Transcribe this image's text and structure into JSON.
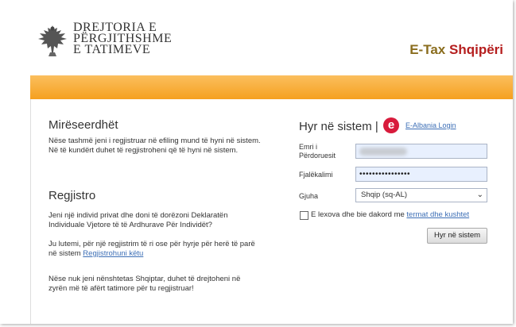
{
  "header": {
    "logo_lines": [
      "DREJTORIA E",
      "PËRGJITHSHME",
      "E TATIMEVE"
    ],
    "brand_prefix": "E-Tax",
    "brand_country": "Shqipëri"
  },
  "welcome": {
    "title": "Mirëseerdhët",
    "text": "Nëse tashmë jeni i regjistruar në efiling mund të hyni në sistem. Në të kundërt duhet të regjistroheni që të hyni në sistem."
  },
  "register": {
    "title": "Regjistro",
    "text1": "Jeni një individ privat dhe doni të dorëzoni Deklaratën Individuale Vjetore të të Ardhurave Për Individët?",
    "text2_prefix": "Ju lutemi, për një regjistrim të ri ose për hyrje për herë të parë në sistem",
    "text2_link": "Regjistrohuni këtu",
    "text3": "Nëse nuk jeni nënshtetas Shqiptar, duhet të drejtoheni në zyrën më të afërt tatimore për tu regjistruar!"
  },
  "login": {
    "title": "Hyr në sistem |",
    "ealbania_icon_letter": "e",
    "ealbania_label": "E-Albania Login",
    "username_label": "Emri i Përdoruesit",
    "username_value": "",
    "password_label": "Fjalëkalimi",
    "password_value": "••••••••••••••••",
    "language_label": "Gjuha",
    "language_value": "Shqip (sq-AL)",
    "terms_prefix": "E lexova dhe bie dakord me",
    "terms_link": "termat dhe kushtet",
    "terms_checked": false,
    "submit_label": "Hyr në sistem"
  },
  "colors": {
    "accent_bar": "#f5a01f",
    "brand_etax": "#8a6d1e",
    "brand_country": "#b51e1e",
    "ealbania_red": "#d81b3c",
    "link": "#3d6fb6"
  }
}
